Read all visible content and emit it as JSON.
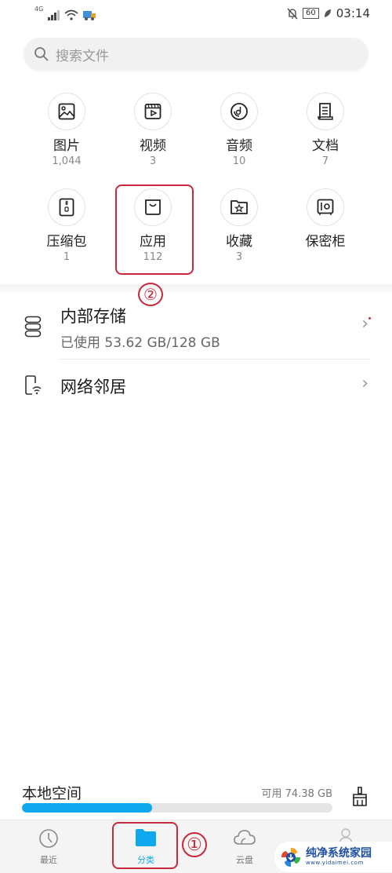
{
  "status_bar": {
    "network_type": "4G",
    "battery_level": "60",
    "time": "03:14",
    "icons": [
      "signal-icon",
      "wifi-icon",
      "app-notification-icon",
      "mute-bell-icon",
      "battery-icon",
      "leaf-icon"
    ]
  },
  "search": {
    "placeholder": "搜索文件",
    "icon": "search-icon"
  },
  "categories": [
    {
      "name": "图片",
      "count": "1,044",
      "icon": "image-icon"
    },
    {
      "name": "视频",
      "count": "3",
      "icon": "video-icon"
    },
    {
      "name": "音频",
      "count": "10",
      "icon": "audio-icon"
    },
    {
      "name": "文档",
      "count": "7",
      "icon": "document-icon"
    },
    {
      "name": "压缩包",
      "count": "1",
      "icon": "archive-icon"
    },
    {
      "name": "应用",
      "count": "112",
      "icon": "app-bag-icon"
    },
    {
      "name": "收藏",
      "count": "3",
      "icon": "favorite-folder-icon"
    },
    {
      "name": "保密柜",
      "count": "",
      "icon": "safe-icon"
    }
  ],
  "annotations": {
    "step1": "①",
    "step2": "②",
    "color": "#c7283a"
  },
  "locations": [
    {
      "title": "内部存储",
      "subtitle": "已使用 53.62 GB/128 GB",
      "icon": "storage-icon",
      "has_dot": true
    },
    {
      "title": "网络邻居",
      "subtitle": "",
      "icon": "network-device-icon",
      "has_dot": false
    }
  ],
  "local_space": {
    "label": "本地空间",
    "available": "可用 74.38 GB",
    "used_fraction": 0.419,
    "accent_color": "#0fa8ef"
  },
  "tabs": [
    {
      "label": "最近",
      "icon": "clock-icon",
      "active": false
    },
    {
      "label": "分类",
      "icon": "folder-icon",
      "active": true
    },
    {
      "label": "云盘",
      "icon": "cloud-icon",
      "active": false
    },
    {
      "label": "",
      "icon": "people-icon",
      "active": false
    }
  ],
  "watermark": {
    "title": "纯净系统家园",
    "url": "www.yidaimei.com"
  }
}
